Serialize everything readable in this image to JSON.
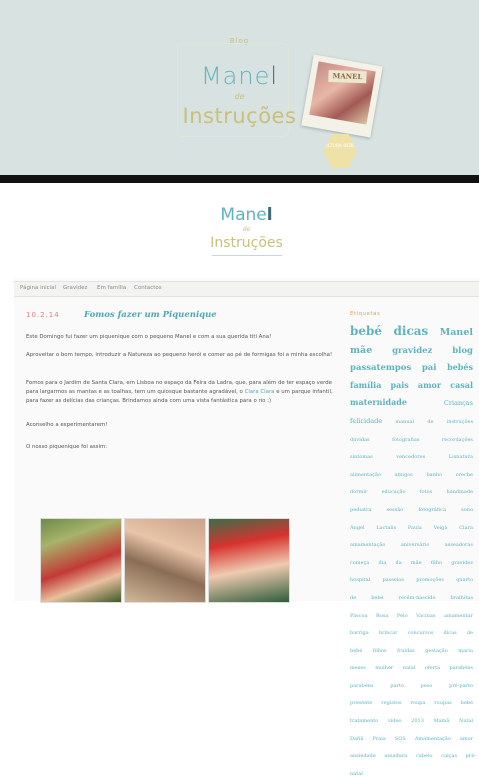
{
  "banner": {
    "small_label": "Blog",
    "title_light": "Mane",
    "title_dark": "l",
    "subtitle": "de",
    "title2": "Instruções",
    "photo_tag": "MANEL",
    "badge_text": "ALTURA BEBE"
  },
  "blog_header": {
    "title_light": "Mane",
    "title_dark": "l",
    "subtitle": "de",
    "title2": "Instruções"
  },
  "nav": {
    "items": [
      "Página inicial",
      "Gravidez",
      "Em família",
      "Contactos"
    ]
  },
  "post": {
    "date": "10.2.14",
    "title": "Fomos fazer um Piquenique",
    "paragraphs": [
      "Este Domingo fui fazer um piquenique com o pequeno Manel e com a sua querida titi Ana!",
      "Aproveitar o bom tempo, introduzir a Natureza ao pequeno herói e comer ao pé de formigas foi a minha escolha!",
      "Fomos para o Jardim de Santa Clara, em Lisboa no espaço da Feira da Ladra, que, para além de ter espaço verde para largarmos as mantas e as toalhas, tem um quiosque bastante agradável, o",
      "Clara Clara",
      "e um parque infantil, para fazer as delícias das crianças. Brindamos ainda com uma vista fantástica para o rio :)",
      "Aconselho a experimentarem!",
      "O nosso piquenique foi assim:"
    ]
  },
  "sidebar": {
    "title": "Etiquetas",
    "tags": [
      "bebé",
      "dicas",
      "Manel",
      "mãe",
      "gravidez",
      "blog",
      "passatempos",
      "pai",
      "bebés",
      "família",
      "pais",
      "amor",
      "casal",
      "maternidade",
      "Crianças",
      "felicidade",
      "manual",
      "de",
      "instruções",
      "dúvidas",
      "fotografias",
      "recordações",
      "sintomas",
      "vencedores",
      "Lisnatura",
      "alimentação",
      "amigos",
      "banho",
      "creche",
      "dormir",
      "educação",
      "fotos",
      "handmade",
      "pediatra",
      "sessão",
      "fotográfica",
      "sono",
      "Ángel",
      "Lactalis",
      "Paula",
      "Veiga",
      "Clara",
      "amamentação",
      "aniversário",
      "asseadoras",
      "começa",
      "dia",
      "da",
      "mãe",
      "filho",
      "gravidez",
      "hospital",
      "passeios",
      "promoções",
      "quarto",
      "de",
      "bebé",
      "recém-nascido",
      "bralhitas",
      "Páscoa",
      "Rosa",
      "Pelo",
      "Vacinas",
      "amamentar",
      "barriga",
      "brincar",
      "concursos",
      "dicas",
      "de",
      "bebé",
      "filhos",
      "fraldas",
      "gestação",
      "maria",
      "meses",
      "mulher",
      "natal",
      "oferta",
      "parabéns",
      "parabéns",
      "parto",
      "peso",
      "pré-parto",
      "presente",
      "registos",
      "roupa",
      "roupas",
      "bebé",
      "tratamento",
      "vídeo",
      "2013",
      "Mamã",
      "Natal",
      "Dafili",
      "Praia",
      "SOS",
      "Amamentação",
      "amor",
      "ansiedade",
      "assadura",
      "cabelo",
      "calças",
      "pré-natal"
    ]
  },
  "colors": {
    "banner_bg": "#d7e2e1",
    "accent_teal": "#5db3c0",
    "accent_gold": "#c9c07a",
    "date_red": "#e77a7a"
  }
}
